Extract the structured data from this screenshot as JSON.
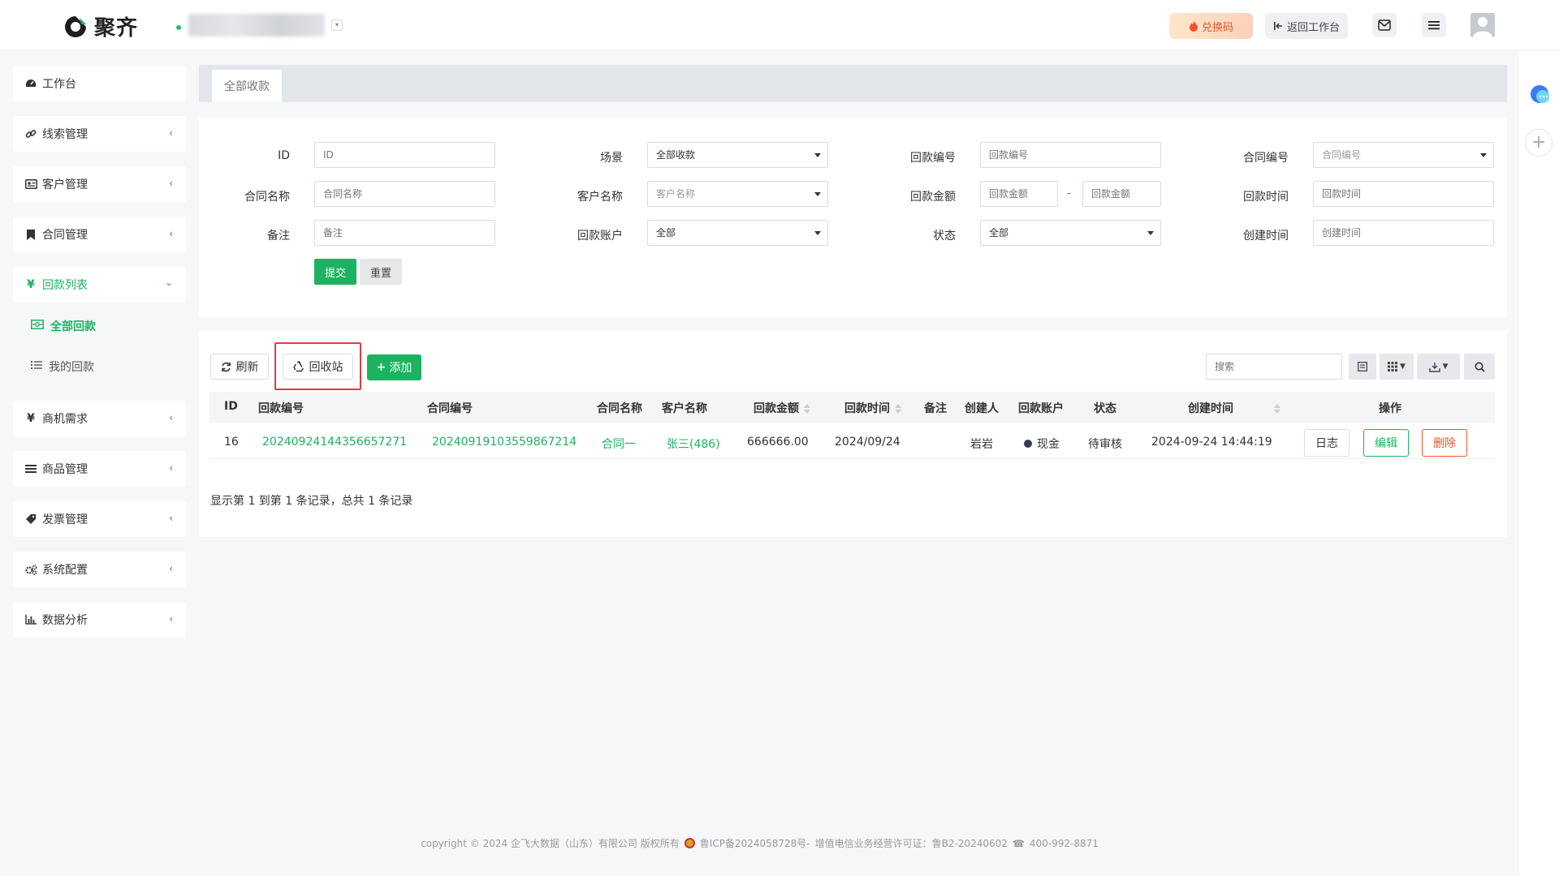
{
  "app": {
    "name": "聚齐"
  },
  "topbar": {
    "exchange_label": "兑换码",
    "back_label": "返回工作台",
    "icons": [
      "mail-icon",
      "menu-icon",
      "avatar"
    ]
  },
  "sidebar": {
    "items": [
      {
        "label": "工作台",
        "icon": "dashboard-icon"
      },
      {
        "label": "线索管理",
        "icon": "link-icon"
      },
      {
        "label": "客户管理",
        "icon": "id-card-icon"
      },
      {
        "label": "合同管理",
        "icon": "bookmark-icon"
      },
      {
        "label": "回款列表",
        "icon": "yen-icon",
        "expanded": true
      },
      {
        "label": "商机需求",
        "icon": "yen-icon"
      },
      {
        "label": "商品管理",
        "icon": "list-icon"
      },
      {
        "label": "发票管理",
        "icon": "tag-icon"
      },
      {
        "label": "系统配置",
        "icon": "gears-icon"
      },
      {
        "label": "数据分析",
        "icon": "bar-chart-icon"
      }
    ],
    "subitems": [
      {
        "label": "全部回款",
        "active": true
      },
      {
        "label": "我的回款",
        "active": false
      }
    ]
  },
  "tabs": [
    {
      "label": "全部收款"
    }
  ],
  "filters": {
    "id": {
      "label": "ID",
      "placeholder": "ID"
    },
    "scene": {
      "label": "场景",
      "value": "全部收款"
    },
    "payment_no": {
      "label": "回款编号",
      "placeholder": "回款编号"
    },
    "contract_no": {
      "label": "合同编号",
      "placeholder": "合同编号"
    },
    "contract_name": {
      "label": "合同名称",
      "placeholder": "合同名称"
    },
    "customer_name": {
      "label": "客户名称",
      "placeholder": "客户名称"
    },
    "amount": {
      "label": "回款金额",
      "placeholder_min": "回款金额",
      "separator": "-",
      "placeholder_max": "回款金额"
    },
    "payment_time": {
      "label": "回款时间",
      "placeholder": "回款时间"
    },
    "remark": {
      "label": "备注",
      "placeholder": "备注"
    },
    "account": {
      "label": "回款账户",
      "value": "全部"
    },
    "status": {
      "label": "状态",
      "value": "全部"
    },
    "created_time": {
      "label": "创建时间",
      "placeholder": "创建时间"
    },
    "submit_label": "提交",
    "reset_label": "重置"
  },
  "toolbar": {
    "refresh_label": "刷新",
    "recycle_label": "回收站",
    "add_label": "添加",
    "search_placeholder": "搜索"
  },
  "table": {
    "headers": {
      "id": "ID",
      "payment_no": "回款编号",
      "contract_no": "合同编号",
      "contract_name": "合同名称",
      "customer_name": "客户名称",
      "amount": "回款金额",
      "payment_time": "回款时间",
      "remark": "备注",
      "creator": "创建人",
      "account": "回款账户",
      "status": "状态",
      "created_time": "创建时间",
      "actions": "操作"
    },
    "rows": [
      {
        "id": "16",
        "payment_no": "20240924144356657271",
        "contract_no": "20240919103559867214",
        "contract_name": "合同一",
        "customer_name": "张三(486)",
        "amount": "666666.00",
        "payment_time": "2024/09/24",
        "remark": "",
        "creator": "岩岩",
        "account": "现金",
        "status": "待审核",
        "created_time": "2024-09-24 14:44:19",
        "actions": {
          "log": "日志",
          "edit": "编辑",
          "delete": "删除"
        }
      }
    ],
    "summary": "显示第 1 到第 1 条记录，总共 1 条记录"
  },
  "footer": {
    "copyright": "copyright © 2024 企飞大数据（山东）有限公司 版权所有",
    "icp": "鲁ICP备2024058728号-",
    "license": "增值电信业务经营许可证：鲁B2-20240602",
    "phone": "400-992-8871"
  },
  "colors": {
    "accent": "#1bb35f",
    "danger": "#e8572b",
    "highlight": "#e03b46"
  }
}
